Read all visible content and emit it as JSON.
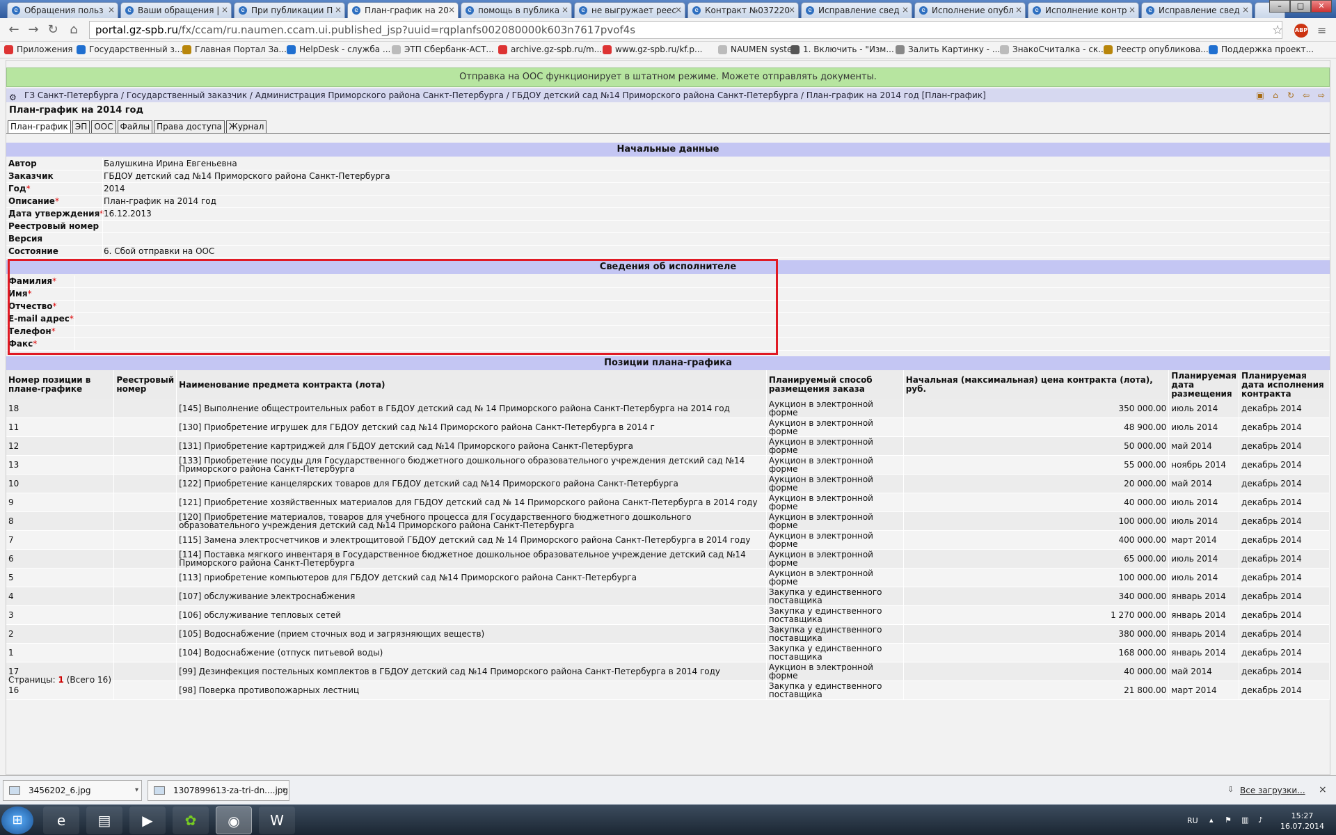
{
  "browser": {
    "tabs": [
      {
        "label": "Обращения польз"
      },
      {
        "label": "Ваши обращения |"
      },
      {
        "label": "При публикации П"
      },
      {
        "label": "План-график на 20"
      },
      {
        "label": "помощь в публика"
      },
      {
        "label": "не выгружает реес"
      },
      {
        "label": "Контракт №037220"
      },
      {
        "label": "Исправление свед"
      },
      {
        "label": "Исполнение опубл"
      },
      {
        "label": "Исполнение контр"
      },
      {
        "label": "Исправление свед"
      }
    ],
    "url_host": "portal.gz-spb.ru",
    "url_path": "/fx/ccam/ru.naumen.ccam.ui.published_jsp?uuid=rqplanfs002080000k603n7617pvof4s",
    "abp": "ABP",
    "bookmarks": [
      {
        "label": "Приложения",
        "color": "#d33"
      },
      {
        "label": "Государственный з...",
        "color": "#1f6fd0"
      },
      {
        "label": "Главная Портал За...",
        "color": "#b8860b"
      },
      {
        "label": "HelpDesk - служба ...",
        "color": "#1f6fd0"
      },
      {
        "label": "ЭТП Сбербанк-АСТ...",
        "color": "#bbb"
      },
      {
        "label": "archive.gz-spb.ru/m...",
        "color": "#d33"
      },
      {
        "label": "www.gz-spb.ru/kf.p...",
        "color": "#d33"
      },
      {
        "label": "NAUMEN system",
        "color": "#bbb"
      },
      {
        "label": "1. Включить - \"Изм...",
        "color": "#555"
      },
      {
        "label": "Залить Картинку - ...",
        "color": "#888"
      },
      {
        "label": "ЗнакоСчиталка - ск...",
        "color": "#bbb"
      },
      {
        "label": "Реестр опубликова...",
        "color": "#b8860b"
      },
      {
        "label": "Поддержка проект...",
        "color": "#1f6fd0"
      }
    ]
  },
  "page": {
    "notice": "Отправка на ООС функционирует в штатном режиме. Можете отправлять документы.",
    "breadcrumb": "ГЗ Санкт-Петербурга / Государственный заказчик / Администрация Приморского района Санкт-Петербурга / ГБДОУ детский сад №14 Приморского района Санкт-Петербурга / План-график на 2014 год [План-график]",
    "title": "План-график на 2014 год",
    "tabs": [
      "План-график",
      "ЭП",
      "ООС",
      "Файлы",
      "Права доступа",
      "Журнал"
    ],
    "initial": {
      "heading": "Начальные данные",
      "fields": [
        {
          "label": "Автор",
          "req": "",
          "value": "Балушкина Ирина Евгеньевна"
        },
        {
          "label": "Заказчик",
          "req": "",
          "value": "ГБДОУ детский сад №14 Приморского района Санкт-Петербурга"
        },
        {
          "label": "Год",
          "req": "*",
          "value": "2014"
        },
        {
          "label": "Описание",
          "req": "*",
          "value": "План-график на 2014 год"
        },
        {
          "label": "Дата утверждения",
          "req": "*",
          "value": "16.12.2013"
        },
        {
          "label": "Реестровый номер",
          "req": "",
          "value": ""
        },
        {
          "label": "Версия",
          "req": "",
          "value": ""
        },
        {
          "label": "Состояние",
          "req": "",
          "value": "6. Сбой отправки на ООС"
        }
      ]
    },
    "executor": {
      "heading": "Сведения об исполнителе",
      "fields": [
        {
          "label": "Фамилия",
          "req": "*"
        },
        {
          "label": "Имя",
          "req": "*"
        },
        {
          "label": "Отчество",
          "req": "*"
        },
        {
          "label": "E-mail адрес",
          "req": "*"
        },
        {
          "label": "Телефон",
          "req": "*"
        },
        {
          "label": "Факс",
          "req": "*"
        }
      ]
    },
    "positions": {
      "heading": "Позиции плана-графика",
      "columns": [
        "Номер позиции в плане-графике",
        "Реестровый номер",
        "Наименование предмета контракта (лота)",
        "Планируемый способ размещения заказа",
        "Начальная (максимальная) цена контракта (лота), руб.",
        "Планируемая дата размещения",
        "Планируемая дата исполнения контракта"
      ],
      "rows": [
        [
          "18",
          "",
          "[145] Выполнение общестроительных работ в ГБДОУ детский сад № 14 Приморского района Санкт-Петербурга на 2014 год",
          "Аукцион в электронной форме",
          "350 000.00",
          "июль 2014",
          "декабрь 2014"
        ],
        [
          "11",
          "",
          "[130] Приобретение игрушек для ГБДОУ детский сад №14 Приморского района Санкт-Петербурга в 2014 г",
          "Аукцион в электронной форме",
          "48 900.00",
          "июль 2014",
          "декабрь 2014"
        ],
        [
          "12",
          "",
          "[131] Приобретение картриджей для ГБДОУ детский сад №14 Приморского района Санкт-Петербурга",
          "Аукцион в электронной форме",
          "50 000.00",
          "май 2014",
          "декабрь 2014"
        ],
        [
          "13",
          "",
          "[133] Приобретение посуды для Государственного бюджетного дошкольного образовательного учреждения детский сад №14 Приморского района Санкт-Петербурга",
          "Аукцион в электронной форме",
          "55 000.00",
          "ноябрь 2014",
          "декабрь 2014"
        ],
        [
          "10",
          "",
          "[122] Приобретение канцелярских товаров для ГБДОУ детский сад №14 Приморского района Санкт-Петербурга",
          "Аукцион в электронной форме",
          "20 000.00",
          "май 2014",
          "декабрь 2014"
        ],
        [
          "9",
          "",
          "[121] Приобретение хозяйственных материалов для ГБДОУ детский сад № 14 Приморского района Санкт-Петербурга в 2014 году",
          "Аукцион в электронной форме",
          "40 000.00",
          "июль 2014",
          "декабрь 2014"
        ],
        [
          "8",
          "",
          "[120] Приобретение материалов, товаров для учебного процесса для Государственного бюджетного дошкольного образовательного учреждения детский сад №14 Приморского района Санкт-Петербурга",
          "Аукцион в электронной форме",
          "100 000.00",
          "июль 2014",
          "декабрь 2014"
        ],
        [
          "7",
          "",
          "[115] Замена электросчетчиков и электрощитовой ГБДОУ детский сад № 14 Приморского района Санкт-Петербурга в 2014 году",
          "Аукцион в электронной форме",
          "400 000.00",
          "март 2014",
          "декабрь 2014"
        ],
        [
          "6",
          "",
          "[114] Поставка мягкого инвентаря в Государственное бюджетное дошкольное образовательное учреждение детский сад №14 Приморского района Санкт-Петербурга",
          "Аукцион в электронной форме",
          "65 000.00",
          "июль 2014",
          "декабрь 2014"
        ],
        [
          "5",
          "",
          "[113] приобретение компьютеров для ГБДОУ детский сад №14 Приморского района Санкт-Петербурга",
          "Аукцион в электронной форме",
          "100 000.00",
          "июль 2014",
          "декабрь 2014"
        ],
        [
          "4",
          "",
          "[107] обслуживание электроснабжения",
          "Закупка у единственного поставщика",
          "340 000.00",
          "январь 2014",
          "декабрь 2014"
        ],
        [
          "3",
          "",
          "[106] обслуживание тепловых сетей",
          "Закупка у единственного поставщика",
          "1 270 000.00",
          "январь 2014",
          "декабрь 2014"
        ],
        [
          "2",
          "",
          "[105] Водоснабжение (прием сточных вод и загрязняющих веществ)",
          "Закупка у единственного поставщика",
          "380 000.00",
          "январь 2014",
          "декабрь 2014"
        ],
        [
          "1",
          "",
          "[104] Водоснабжение (отпуск питьевой воды)",
          "Закупка у единственного поставщика",
          "168 000.00",
          "январь 2014",
          "декабрь 2014"
        ],
        [
          "17",
          "",
          "[99] Дезинфекция постельных комплектов в ГБДОУ детский сад №14 Приморского района Санкт-Петербурга в 2014 году",
          "Аукцион в электронной форме",
          "40 000.00",
          "май 2014",
          "декабрь 2014"
        ],
        [
          "16",
          "",
          "[98] Поверка противопожарных лестниц",
          "Закупка у единственного поставщика",
          "21 800.00",
          "март 2014",
          "декабрь 2014"
        ]
      ]
    },
    "pager": {
      "label": "Страницы:",
      "current": "1",
      "total": "(Всего 16)"
    }
  },
  "downloads": {
    "items": [
      "3456202_6.jpg",
      "1307899613-za-tri-dn....jpg"
    ],
    "all_label": "Все загрузки...",
    "close": "×"
  },
  "taskbar": {
    "lang": "RU",
    "time": "15:27",
    "date": "16.07.2014"
  }
}
